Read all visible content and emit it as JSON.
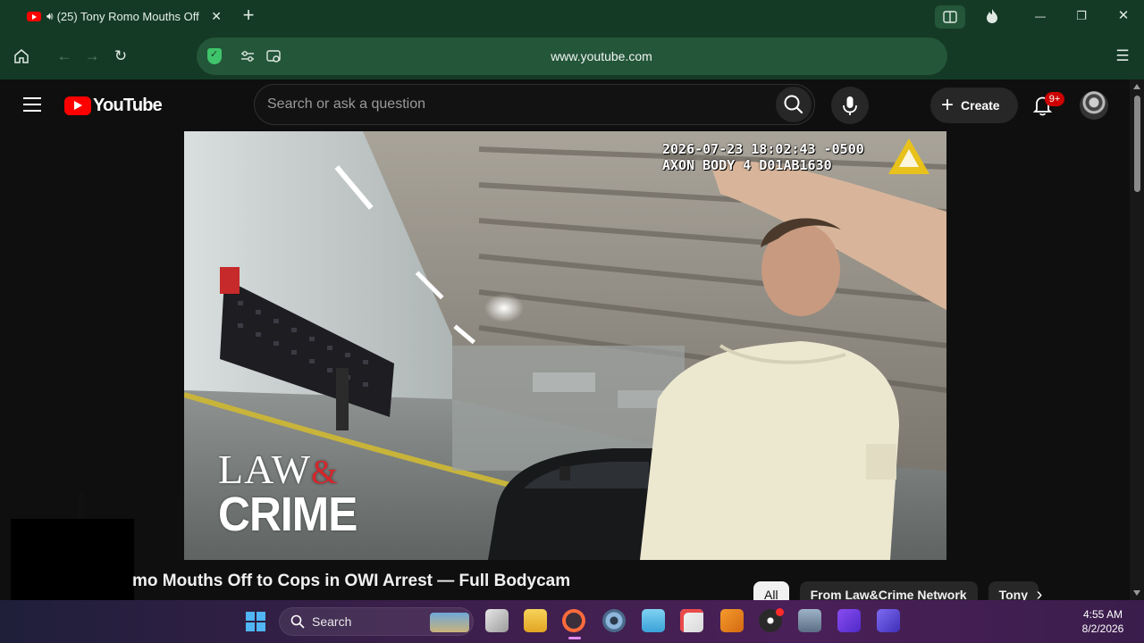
{
  "browser": {
    "tab_title": "(25) Tony Romo Mouths Off",
    "tab_close": "✕",
    "new_tab": "+",
    "url": "www.youtube.com",
    "window_controls": {
      "minimize": "—",
      "restore": "❐",
      "close": "✕"
    }
  },
  "youtube": {
    "logo_text": "YouTube",
    "search_placeholder": "Search or ask a question",
    "create_label": "Create",
    "notification_badge": "9+"
  },
  "video": {
    "timestamp_line1": "2026-07-23 18:02:43 -0500",
    "timestamp_line2": "AXON BODY 4 D01AB1630",
    "watermark_law": "LAW",
    "watermark_amp": "&",
    "watermark_crime": "CRIME",
    "title": "mo Mouths Off to Cops in OWI Arrest — Full Bodycam"
  },
  "chips": [
    "All",
    "From Law&Crime Network",
    "Tony"
  ],
  "taskbar": {
    "search_label": "Search",
    "time": "4:55 AM",
    "date": "8/2/2026"
  },
  "colors": {
    "browser_chrome": "#143a25",
    "url_field": "#24563a",
    "youtube_red": "#ff0000",
    "badge_red": "#cc0000"
  }
}
